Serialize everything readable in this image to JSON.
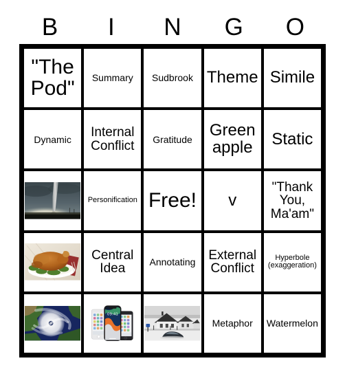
{
  "card": {
    "title_letters": [
      "B",
      "I",
      "N",
      "G",
      "O"
    ],
    "columns": 5,
    "rows": 5,
    "border_color": "#000000",
    "background_color": "#ffffff"
  },
  "cells": [
    {
      "id": "b1",
      "column": "B",
      "row": 1,
      "type": "text",
      "text": "\"The Pod\"",
      "size": "xl"
    },
    {
      "id": "i1",
      "column": "I",
      "row": 1,
      "type": "text",
      "text": "Summary",
      "size": "sm"
    },
    {
      "id": "n1",
      "column": "N",
      "row": 1,
      "type": "text",
      "text": "Sudbrook",
      "size": "sm"
    },
    {
      "id": "g1",
      "column": "G",
      "row": 1,
      "type": "text",
      "text": "Theme",
      "size": "lg"
    },
    {
      "id": "o1",
      "column": "O",
      "row": 1,
      "type": "text",
      "text": "Simile",
      "size": "lg"
    },
    {
      "id": "b2",
      "column": "B",
      "row": 2,
      "type": "text",
      "text": "Dynamic",
      "size": "sm"
    },
    {
      "id": "i2",
      "column": "I",
      "row": 2,
      "type": "text",
      "text": "Internal Conflict",
      "size": "md"
    },
    {
      "id": "n2",
      "column": "N",
      "row": 2,
      "type": "text",
      "text": "Gratitude",
      "size": "sm"
    },
    {
      "id": "g2",
      "column": "G",
      "row": 2,
      "type": "text",
      "text": "Green apple",
      "size": "lg"
    },
    {
      "id": "o2",
      "column": "O",
      "row": 2,
      "type": "text",
      "text": "Static",
      "size": "lg"
    },
    {
      "id": "b3",
      "column": "B",
      "row": 3,
      "type": "image",
      "image": "tornado-photo",
      "alt": "Tornado funnel over a field under dark storm clouds"
    },
    {
      "id": "i3",
      "column": "I",
      "row": 3,
      "type": "text",
      "text": "Personification",
      "size": "xs"
    },
    {
      "id": "n3",
      "column": "N",
      "row": 3,
      "type": "text",
      "text": "Free!",
      "size": "xl",
      "free_space": true
    },
    {
      "id": "g3",
      "column": "G",
      "row": 3,
      "type": "text",
      "text": "v",
      "size": "lg"
    },
    {
      "id": "o3",
      "column": "O",
      "row": 3,
      "type": "text",
      "text": "\"Thank You, Ma'am\"",
      "size": "md"
    },
    {
      "id": "b4",
      "column": "B",
      "row": 4,
      "type": "image",
      "image": "roast-turkey-photo",
      "alt": "Roast turkey on a white platter with green garnish"
    },
    {
      "id": "i4",
      "column": "I",
      "row": 4,
      "type": "text",
      "text": "Central Idea",
      "size": "md"
    },
    {
      "id": "n4",
      "column": "N",
      "row": 4,
      "type": "text",
      "text": "Annotating",
      "size": "sm"
    },
    {
      "id": "g4",
      "column": "G",
      "row": 4,
      "type": "text",
      "text": "External Conflict",
      "size": "md"
    },
    {
      "id": "o4",
      "column": "O",
      "row": 4,
      "type": "text",
      "text": "Hyperbole (exaggeration)",
      "size": "xs"
    },
    {
      "id": "b5",
      "column": "B",
      "row": 5,
      "type": "image",
      "image": "hurricane-satellite-photo",
      "alt": "Satellite view of a hurricane with visible eye over the ocean"
    },
    {
      "id": "i5",
      "column": "I",
      "row": 5,
      "type": "image",
      "image": "smartphones-photo",
      "alt": "Three smartphones displaying home screens"
    },
    {
      "id": "n5",
      "column": "N",
      "row": 5,
      "type": "image",
      "image": "flood-snow-photo",
      "alt": "Black and white photo of houses and a half-buried car in snow"
    },
    {
      "id": "g5",
      "column": "G",
      "row": 5,
      "type": "text",
      "text": "Metaphor",
      "size": "sm"
    },
    {
      "id": "o5",
      "column": "O",
      "row": 5,
      "type": "text",
      "text": "Watermelon",
      "size": "sm"
    }
  ],
  "image_colors": {
    "tornado_sky": "#4e5a5e",
    "tornado_sky_dark": "#39454a",
    "tornado_glow": "#f3f1e2",
    "tornado_funnel": "#c9c9c7",
    "tornado_ground": "#0d0f0a",
    "turkey_skin": "#b5651d",
    "turkey_skin_dark": "#8a4512",
    "turkey_plate": "#f2efe8",
    "turkey_garnish": "#4f7f2d",
    "turkey_napkin": "#8f1d1d",
    "turkey_background": "#ded6c8",
    "hurricane_ocean": "#1b2a6b",
    "hurricane_land": "#3f6b2e",
    "hurricane_land_tan": "#8a7a4a",
    "hurricane_cloud": "#f0f0f0",
    "phone_body_dark": "#1a1a1c",
    "phone_body_light": "#e9e9ea",
    "phone_screen_orange": "#e8722a",
    "phone_screen_blue": "#2b4f8e",
    "phone_screen_green": "#3da06a",
    "flood_gray_dark": "#3a3a3a",
    "flood_gray_mid": "#8c8c8c",
    "flood_snow": "#e6e6e6",
    "flood_mailbox_blue": "#2b57a8"
  }
}
